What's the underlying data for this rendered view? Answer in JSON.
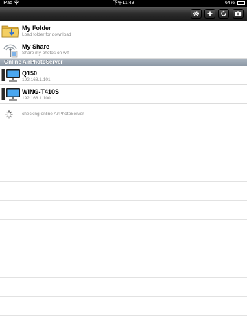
{
  "status_bar": {
    "carrier": "iPad",
    "time": "下午11:49",
    "battery": "64%",
    "battery_level": 0.64
  },
  "toolbar": {
    "buttons": [
      "gear-icon",
      "plus-icon",
      "refresh-icon",
      "camera-icon"
    ]
  },
  "local_items": [
    {
      "title": "My Folder",
      "subtitle": "Load folder for download",
      "icon": "folder-icon"
    },
    {
      "title": "My Share",
      "subtitle": "Share my photos on wifi",
      "icon": "wifi-share-icon"
    }
  ],
  "section_header": "Online AirPhotoServer",
  "servers": [
    {
      "name": "Q150",
      "ip": "192.168.1.101",
      "icon": "computer-icon"
    },
    {
      "name": "WING-T410S",
      "ip": "192.168.1.100",
      "icon": "computer-icon"
    }
  ],
  "checking_text": "checking online AirPhotoServer",
  "colors": {
    "toolbar": "#2c2c2c",
    "section_header": "#8d99a6",
    "subtitle": "#8a8a8a"
  }
}
